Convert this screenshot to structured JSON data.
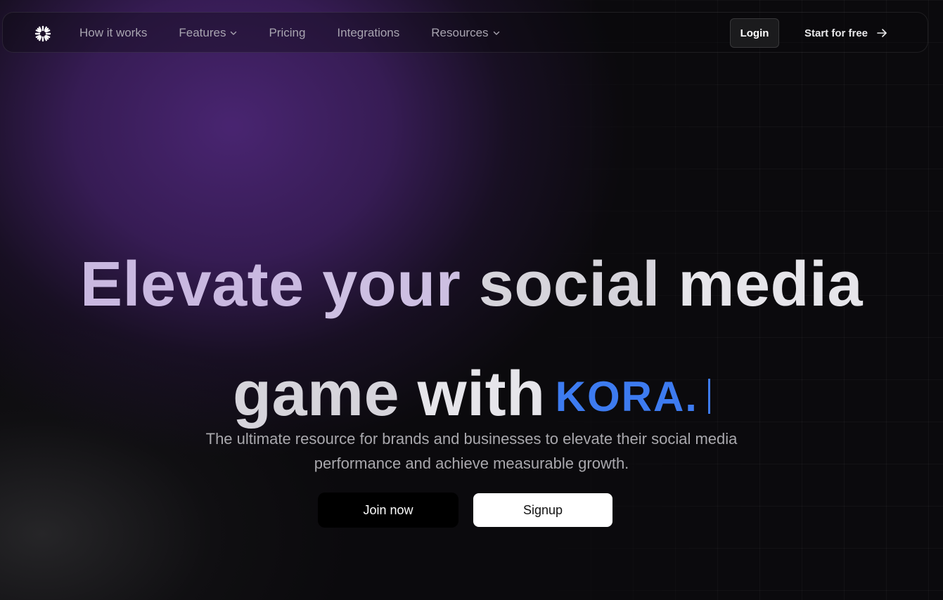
{
  "nav": {
    "logo_icon": "sunburst-logo-icon",
    "links": [
      {
        "label": "How it works",
        "has_dropdown": false
      },
      {
        "label": "Features",
        "has_dropdown": true
      },
      {
        "label": "Pricing",
        "has_dropdown": false
      },
      {
        "label": "Integrations",
        "has_dropdown": false
      },
      {
        "label": "Resources",
        "has_dropdown": true
      }
    ],
    "login_label": "Login",
    "start_label": "Start for free",
    "start_icon": "arrow-right-icon"
  },
  "hero": {
    "words_line1": [
      "Elevate",
      "your",
      "social",
      "media"
    ],
    "words_line2": [
      "game",
      "with"
    ],
    "brand": "KORA.",
    "subtitle_line1": "The ultimate resource for brands and businesses to elevate their social media",
    "subtitle_line2": "performance and achieve measurable growth.",
    "join_label": "Join now",
    "signup_label": "Signup"
  },
  "colors": {
    "accent": "#3d7bf0",
    "background": "#0b0a0d",
    "glow": "#4c2676",
    "headline_lavender": "#c9b8e0",
    "headline_grey": "#e6e5ea"
  }
}
